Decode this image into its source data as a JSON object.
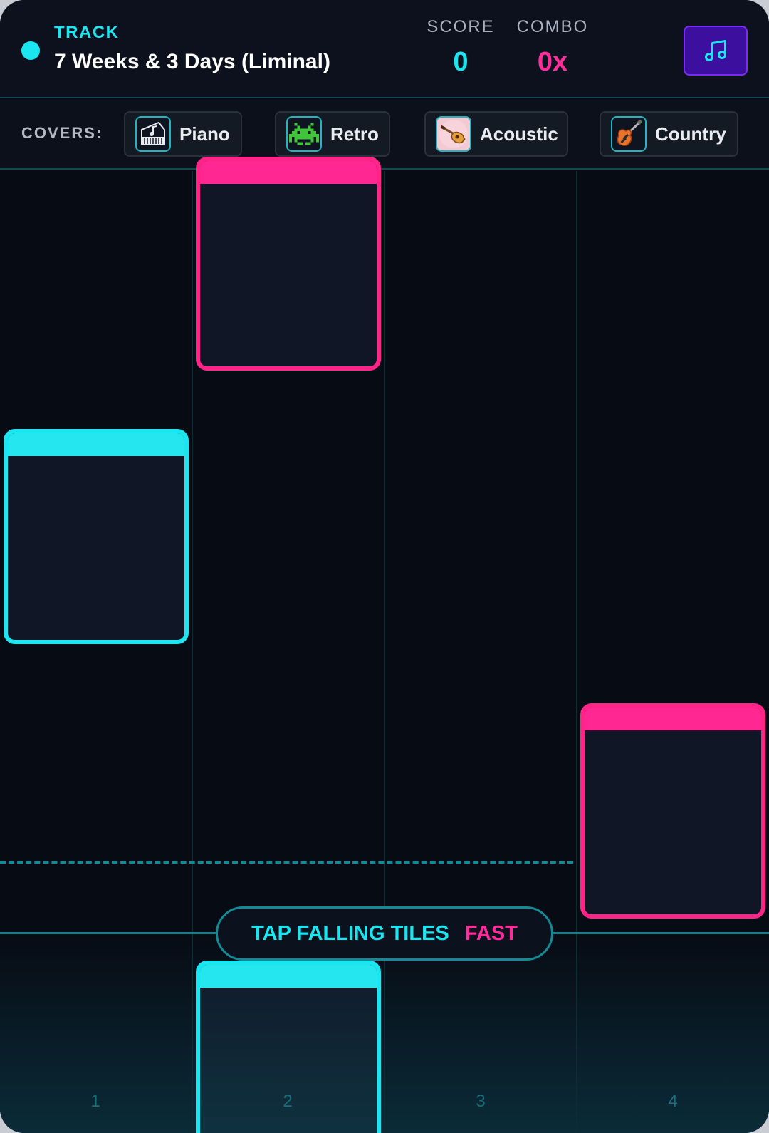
{
  "header": {
    "track_label": "TRACK",
    "track_title": "7 Weeks & 3 Days (Liminal)",
    "score_label": "SCORE",
    "score_value": "0",
    "combo_label": "COMBO",
    "combo_value": "0x",
    "music_button_icon": "music-note-icon"
  },
  "covers": {
    "label": "COVERS:",
    "items": [
      {
        "label": "Piano",
        "icon": "piano-icon"
      },
      {
        "label": "Retro",
        "icon": "space-invader-icon"
      },
      {
        "label": "Acoustic",
        "icon": "acoustic-guitar-icon"
      },
      {
        "label": "Country",
        "icon": "electric-guitar-icon"
      }
    ]
  },
  "lanes": [
    "1",
    "2",
    "3",
    "4"
  ],
  "hint": {
    "text": "TAP FALLING TILES",
    "accent": "FAST"
  },
  "tiles": [
    {
      "lane": 2,
      "color": "pink"
    },
    {
      "lane": 1,
      "color": "cyan"
    },
    {
      "lane": 4,
      "color": "pink"
    },
    {
      "lane": 2,
      "color": "cyan"
    }
  ],
  "colors": {
    "cyan": "#19e6f0",
    "pink": "#ff2c9c",
    "background": "#070b14",
    "music_button": "#3d0f9e"
  }
}
